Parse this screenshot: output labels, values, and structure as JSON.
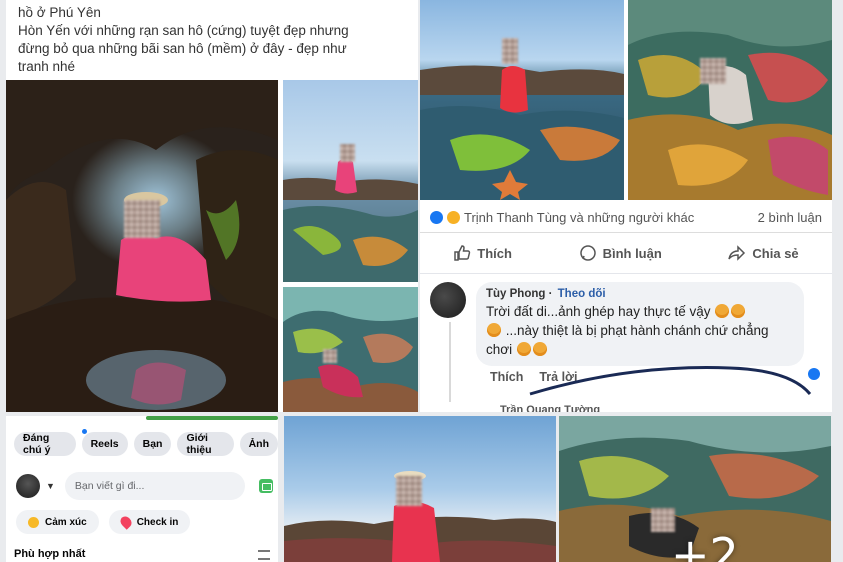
{
  "post_left": {
    "caption_lines": [
      "hồ ở Phú Yên",
      "Hòn Yến với những rạn san hô (cứng) tuyệt đẹp nhưng",
      "đừng bỏ qua những bãi san hô (mềm) ở đây - đẹp như",
      "tranh nhé"
    ]
  },
  "post_right": {
    "reactions_text": "Trịnh Thanh Tùng và những người khác",
    "comments_count": "2 bình luận",
    "actions": {
      "like": "Thích",
      "comment": "Bình luận",
      "share": "Chia sẻ"
    },
    "comment": {
      "author": "Tùy Phong",
      "follow": "Theo dõi",
      "lines": [
        "Trời đất di...ảnh ghép hay thực tế vậy",
        "...này thiệt là bị phạt hành chánh chứ chẳng",
        "chơi"
      ],
      "like": "Thích",
      "reply": "Trả lời"
    },
    "sub_reply_author": "Trần Quang Tường"
  },
  "profile": {
    "chips": [
      "Đáng chú ý",
      "Reels",
      "Bạn",
      "Giới thiệu",
      "Ảnh"
    ],
    "composer_placeholder": "Bạn viết gì đi...",
    "mood_label": "Cảm xúc",
    "checkin_label": "Check in",
    "section_title": "Phù hợp nhất"
  },
  "gallery": {
    "more_count": "+2"
  },
  "colors": {
    "facebook_blue": "#1877f2",
    "like_blue": "#2c5ea8",
    "green_accent": "#43a047"
  }
}
